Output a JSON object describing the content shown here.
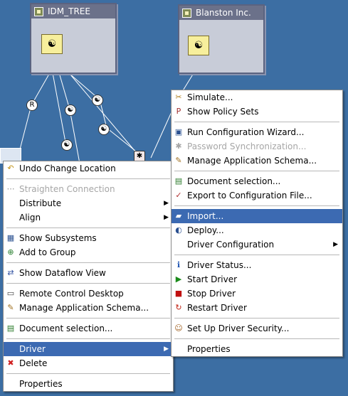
{
  "trees": {
    "left": {
      "title": "IDM_TREE"
    },
    "right": {
      "title": "Blanston Inc."
    }
  },
  "colors": {
    "background": "#3c6ea3",
    "highlight": "#3c6ab2"
  },
  "left_menu": {
    "items": [
      {
        "label": "Undo Change Location",
        "icon": "undo-arrow-icon",
        "disabled": false
      },
      {
        "sep": true
      },
      {
        "label": "Straighten Connection",
        "icon": "connection-icon",
        "disabled": true
      },
      {
        "label": "Distribute",
        "submenu": true
      },
      {
        "label": "Align",
        "submenu": true
      },
      {
        "sep": true
      },
      {
        "label": "Show Subsystems",
        "icon": "subsystems-icon"
      },
      {
        "label": "Add to Group",
        "icon": "add-group-icon"
      },
      {
        "sep": true
      },
      {
        "label": "Show Dataflow View",
        "icon": "dataflow-icon"
      },
      {
        "sep": true
      },
      {
        "label": "Remote Control Desktop",
        "icon": "monitor-icon"
      },
      {
        "label": "Manage Application Schema...",
        "icon": "schema-icon"
      },
      {
        "sep": true
      },
      {
        "label": "Document selection...",
        "icon": "document-icon"
      },
      {
        "sep": true
      },
      {
        "label": "Driver",
        "submenu": true,
        "highlighted": true
      },
      {
        "label": "Delete",
        "icon": "delete-x-icon"
      },
      {
        "sep": true
      },
      {
        "label": "Properties"
      }
    ]
  },
  "right_menu": {
    "items": [
      {
        "label": "Simulate...",
        "icon": "simulate-icon"
      },
      {
        "label": "Show Policy Sets",
        "icon": "policy-icon"
      },
      {
        "sep": true
      },
      {
        "label": "Run Configuration Wizard...",
        "icon": "wizard-icon"
      },
      {
        "label": "Password Synchronization...",
        "icon": "password-icon",
        "disabled": true
      },
      {
        "label": "Manage Application Schema...",
        "icon": "schema-icon"
      },
      {
        "sep": true
      },
      {
        "label": "Document selection...",
        "icon": "document-icon"
      },
      {
        "label": "Export to Configuration File...",
        "icon": "export-icon"
      },
      {
        "sep": true
      },
      {
        "label": "Import...",
        "icon": "import-folder-icon",
        "highlighted": true
      },
      {
        "label": "Deploy...",
        "icon": "deploy-icon"
      },
      {
        "label": "Driver Configuration",
        "submenu": true
      },
      {
        "sep": true
      },
      {
        "label": "Driver Status...",
        "icon": "info-icon"
      },
      {
        "label": "Start Driver",
        "icon": "start-icon"
      },
      {
        "label": "Stop Driver",
        "icon": "stop-icon"
      },
      {
        "label": "Restart Driver",
        "icon": "restart-icon"
      },
      {
        "sep": true
      },
      {
        "label": "Set Up Driver Security...",
        "icon": "security-user-icon"
      },
      {
        "sep": true
      },
      {
        "label": "Properties"
      }
    ]
  }
}
